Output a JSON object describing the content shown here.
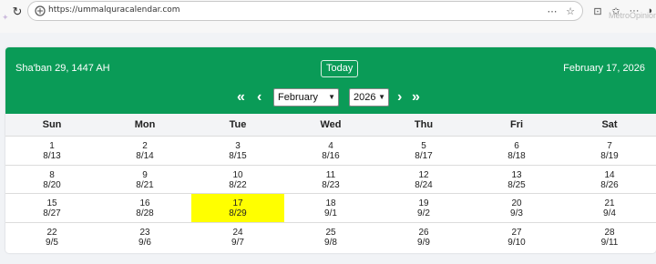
{
  "browser": {
    "url": "https://ummalquracalendar.com",
    "faded_right": "MetroOpinion"
  },
  "header": {
    "hijri_date": "Sha'ban 29, 1447 AH",
    "today_label": "Today",
    "gregorian_date": "February 17, 2026",
    "month_value": "February",
    "year_value": "2026",
    "first_glyph": "«",
    "prev_glyph": "‹",
    "next_glyph": "›",
    "last_glyph": "»"
  },
  "weekdays": [
    "Sun",
    "Mon",
    "Tue",
    "Wed",
    "Thu",
    "Fri",
    "Sat"
  ],
  "weeks": [
    [
      [
        "1",
        "8/13"
      ],
      [
        "2",
        "8/14"
      ],
      [
        "3",
        "8/15"
      ],
      [
        "4",
        "8/16"
      ],
      [
        "5",
        "8/17"
      ],
      [
        "6",
        "8/18"
      ],
      [
        "7",
        "8/19"
      ]
    ],
    [
      [
        "8",
        "8/20"
      ],
      [
        "9",
        "8/21"
      ],
      [
        "10",
        "8/22"
      ],
      [
        "11",
        "8/23"
      ],
      [
        "12",
        "8/24"
      ],
      [
        "13",
        "8/25"
      ],
      [
        "14",
        "8/26"
      ]
    ],
    [
      [
        "15",
        "8/27"
      ],
      [
        "16",
        "8/28"
      ],
      [
        "17",
        "8/29"
      ],
      [
        "18",
        "9/1"
      ],
      [
        "19",
        "9/2"
      ],
      [
        "20",
        "9/3"
      ],
      [
        "21",
        "9/4"
      ]
    ],
    [
      [
        "22",
        "9/5"
      ],
      [
        "23",
        "9/6"
      ],
      [
        "24",
        "9/7"
      ],
      [
        "25",
        "9/8"
      ],
      [
        "26",
        "9/9"
      ],
      [
        "27",
        "9/10"
      ],
      [
        "28",
        "9/11"
      ]
    ]
  ],
  "highlighted_day": "17",
  "colors": {
    "header": "#0a9b57",
    "highlight": "#ffff00"
  }
}
